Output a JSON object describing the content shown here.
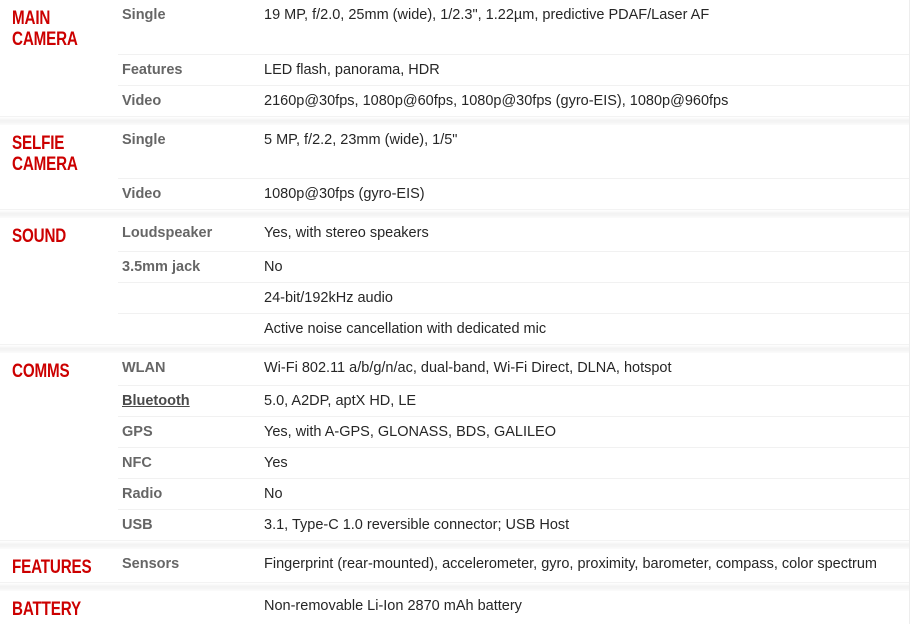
{
  "page": {
    "title": "Phone specifications table",
    "accent_color": "#cc0000",
    "label_color": "#666666",
    "value_color": "#262626",
    "background": "#ffffff"
  },
  "sections": [
    {
      "title": "MAIN\nCAMERA",
      "name": "main-camera",
      "rows": [
        {
          "label": "Single",
          "value": "19 MP, f/2.0, 25mm (wide), 1/2.3\", 1.22µm, predictive PDAF/Laser AF",
          "link": false
        },
        {
          "label": "Features",
          "value": "LED flash, panorama, HDR",
          "link": false
        },
        {
          "label": "Video",
          "value": "2160p@30fps, 1080p@60fps, 1080p@30fps (gyro-EIS), 1080p@960fps",
          "link": false
        }
      ]
    },
    {
      "title": "SELFIE\nCAMERA",
      "name": "selfie-camera",
      "rows": [
        {
          "label": "Single",
          "value": "5 MP, f/2.2, 23mm (wide), 1/5\"",
          "link": false
        },
        {
          "label": "Video",
          "value": "1080p@30fps (gyro-EIS)",
          "link": false
        }
      ]
    },
    {
      "title": "SOUND",
      "name": "sound",
      "rows": [
        {
          "label": "Loudspeaker",
          "value": "Yes, with stereo speakers",
          "link": false
        },
        {
          "label": "3.5mm jack",
          "value": "No",
          "link": false
        },
        {
          "label": "",
          "value": "24-bit/192kHz audio",
          "link": false
        },
        {
          "label": "",
          "value": "Active noise cancellation with dedicated mic",
          "link": false
        }
      ]
    },
    {
      "title": "COMMS",
      "name": "comms",
      "rows": [
        {
          "label": "WLAN",
          "value": "Wi-Fi 802.11 a/b/g/n/ac, dual-band, Wi-Fi Direct, DLNA, hotspot",
          "link": false
        },
        {
          "label": "Bluetooth",
          "value": "5.0, A2DP, aptX HD, LE",
          "link": true
        },
        {
          "label": "GPS",
          "value": "Yes, with A-GPS, GLONASS, BDS, GALILEO",
          "link": false
        },
        {
          "label": "NFC",
          "value": "Yes",
          "link": false
        },
        {
          "label": "Radio",
          "value": "No",
          "link": false
        },
        {
          "label": "USB",
          "value": "3.1, Type-C 1.0 reversible connector; USB Host",
          "link": false
        }
      ]
    },
    {
      "title": "FEATURES",
      "name": "features",
      "rows": [
        {
          "label": "Sensors",
          "value": "Fingerprint (rear-mounted), accelerometer, gyro, proximity, barometer, compass, color spectrum",
          "link": false
        }
      ]
    },
    {
      "title": "BATTERY",
      "name": "battery",
      "rows": [
        {
          "label": "",
          "value": "Non-removable Li-Ion 2870 mAh battery",
          "link": false
        }
      ]
    }
  ]
}
